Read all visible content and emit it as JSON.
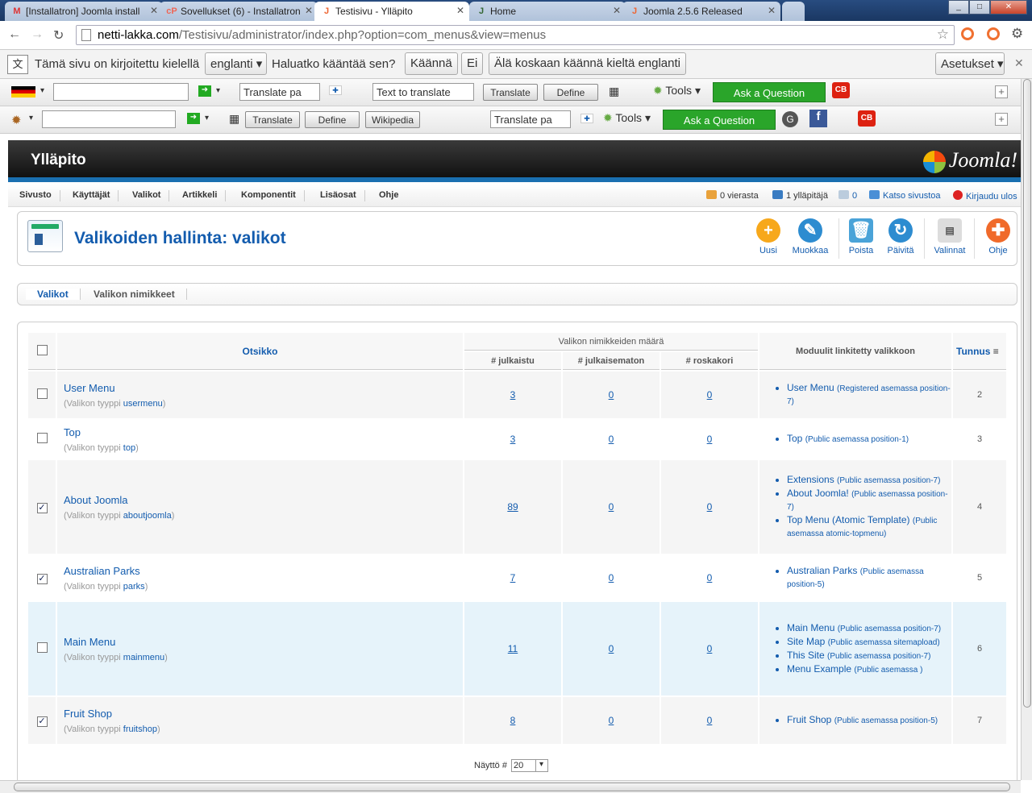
{
  "browser": {
    "tabs": [
      {
        "title": "[Installatron] Joomla install",
        "icon": "M"
      },
      {
        "title": "Sovellukset (6) - Installatron",
        "icon": "cP"
      },
      {
        "title": "Testisivu - Ylläpito",
        "icon": "J"
      },
      {
        "title": "Home",
        "icon": "J"
      },
      {
        "title": "Joomla 2.5.6 Released",
        "icon": "J"
      }
    ],
    "url_host": "netti-lakka.com",
    "url_path": "/Testisivu/administrator/index.php?option=com_menus&view=menus"
  },
  "translate_bar": {
    "message": "Tämä sivu on kirjoitettu kielellä",
    "language": "englanti",
    "question": "Haluatko kääntää sen?",
    "translate": "Käännä",
    "no": "Ei",
    "never": "Älä koskaan käännä kieltä englanti",
    "options": "Asetukset"
  },
  "toolbar1": {
    "translate_page": "Translate pa",
    "text_to_translate": "Text to translate",
    "translate": "Translate",
    "define": "Define",
    "tools": "Tools",
    "ask": "Ask a Question"
  },
  "toolbar2": {
    "translate": "Translate",
    "define": "Define",
    "wikipedia": "Wikipedia",
    "translate_page": "Translate pa",
    "tools": "Tools",
    "ask": "Ask a Question"
  },
  "admin": {
    "site_name": "Ylläpito",
    "logo": "Joomla!",
    "menu": [
      "Sivusto",
      "Käyttäjät",
      "Valikot",
      "Artikkeli",
      "Komponentit",
      "Lisäosat",
      "Ohje"
    ],
    "visitors": "0 vierasta",
    "admins": "1 ylläpitäjä",
    "messages": "0",
    "view_site": "Katso sivustoa",
    "logout": "Kirjaudu ulos",
    "page_title": "Valikoiden hallinta: valikot",
    "toolbar": [
      "Uusi",
      "Muokkaa",
      "Poista",
      "Päivitä",
      "Valinnat",
      "Ohje"
    ],
    "subnav": [
      "Valikot",
      "Valikon nimikkeet"
    ]
  },
  "table": {
    "col_title": "Otsikko",
    "col_group": "Valikon nimikkeiden määrä",
    "col_published": "# julkaistu",
    "col_unpublished": "# julkaisematon",
    "col_trashed": "# roskakori",
    "col_modules": "Moduulit linkitetty valikkoon",
    "col_id": "Tunnus",
    "type_prefix": "(Valikon tyyppi",
    "rows": [
      {
        "title": "User Menu",
        "type": "usermenu",
        "published": "3",
        "unpublished": "0",
        "trashed": "0",
        "checked": false,
        "id": "2",
        "modules": [
          {
            "name": "User Menu",
            "info": "(Registered asemassa position-7)"
          }
        ]
      },
      {
        "title": "Top",
        "type": "top",
        "published": "3",
        "unpublished": "0",
        "trashed": "0",
        "checked": false,
        "id": "3",
        "modules": [
          {
            "name": "Top",
            "info": "(Public asemassa position-1)"
          }
        ]
      },
      {
        "title": "About Joomla",
        "type": "aboutjoomla",
        "published": "89",
        "unpublished": "0",
        "trashed": "0",
        "checked": true,
        "id": "4",
        "modules": [
          {
            "name": "Extensions",
            "info": "(Public asemassa position-7)"
          },
          {
            "name": "About Joomla!",
            "info": "(Public asemassa position-7)"
          },
          {
            "name": "Top Menu (Atomic Template)",
            "info": "(Public asemassa atomic-topmenu)"
          }
        ]
      },
      {
        "title": "Australian Parks",
        "type": "parks",
        "published": "7",
        "unpublished": "0",
        "trashed": "0",
        "checked": true,
        "id": "5",
        "modules": [
          {
            "name": "Australian Parks",
            "info": "(Public asemassa position-5)"
          }
        ]
      },
      {
        "title": "Main Menu",
        "type": "mainmenu",
        "published": "11",
        "unpublished": "0",
        "trashed": "0",
        "checked": false,
        "id": "6",
        "modules": [
          {
            "name": "Main Menu",
            "info": "(Public asemassa position-7)"
          },
          {
            "name": "Site Map",
            "info": "(Public asemassa sitemapload)"
          },
          {
            "name": "This Site",
            "info": "(Public asemassa position-7)"
          },
          {
            "name": "Menu Example",
            "info": "(Public asemassa )"
          }
        ]
      },
      {
        "title": "Fruit Shop",
        "type": "fruitshop",
        "published": "8",
        "unpublished": "0",
        "trashed": "0",
        "checked": true,
        "id": "7",
        "modules": [
          {
            "name": "Fruit Shop",
            "info": "(Public asemassa position-5)"
          }
        ]
      }
    ]
  },
  "pagination": {
    "label": "Näyttö #",
    "value": "20"
  }
}
